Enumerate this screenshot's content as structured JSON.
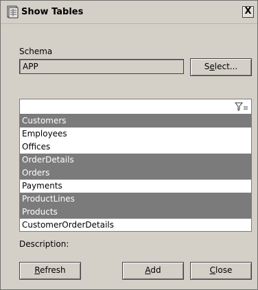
{
  "window": {
    "title": "Show Tables",
    "close_glyph": "X"
  },
  "schema": {
    "label": "Schema",
    "value": "APP",
    "select_label_pre": "S",
    "select_label_mn": "e",
    "select_label_post": "lect..."
  },
  "tables": [
    {
      "name": "Customers",
      "selected": true
    },
    {
      "name": "Employees",
      "selected": false
    },
    {
      "name": "Offices",
      "selected": false
    },
    {
      "name": "OrderDetails",
      "selected": true
    },
    {
      "name": "Orders",
      "selected": true
    },
    {
      "name": "Payments",
      "selected": false
    },
    {
      "name": "ProductLines",
      "selected": true
    },
    {
      "name": "Products",
      "selected": true
    },
    {
      "name": "CustomerOrderDetails",
      "selected": false
    }
  ],
  "description_label": "Description:",
  "buttons": {
    "refresh": {
      "mn": "R",
      "rest": "efresh"
    },
    "add": {
      "mn": "A",
      "rest": "dd"
    },
    "close": {
      "mn": "C",
      "rest": "lose"
    }
  },
  "icons": {
    "app": "table-window-icon",
    "filter": "filter-icon",
    "close": "close-icon"
  }
}
